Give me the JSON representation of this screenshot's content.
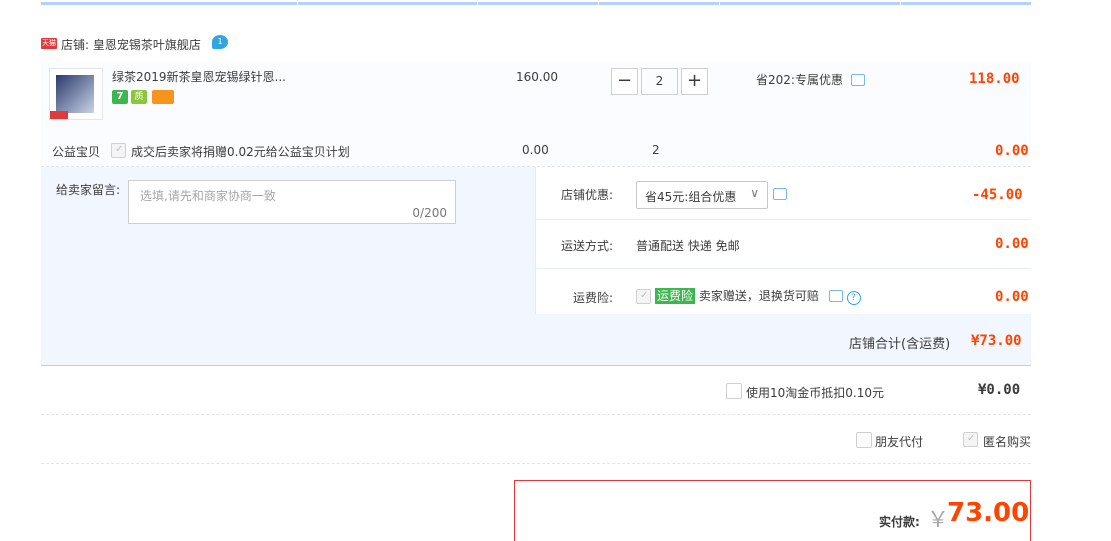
{
  "shop": {
    "badge": "天猫",
    "label": "店铺: 皇恩宠锡茶叶旗舰店",
    "wangwang": "1"
  },
  "item": {
    "title": "绿茶2019新茶皇恩宠锡绿针恩...",
    "badges": [
      {
        "icon": "seven-day-return-icon",
        "color": "#3db64e",
        "text": "7"
      },
      {
        "icon": "certified-icon",
        "color": "#8cc63f",
        "text": "质"
      },
      {
        "icon": "credit-card-icon",
        "color": "#f7941d",
        "text": ""
      }
    ],
    "unit_price": "160.00",
    "quantity": "2",
    "promo": "省202:专属优惠",
    "subtotal": "118.00"
  },
  "charity": {
    "label": "公益宝贝",
    "text": "成交后卖家将捐赠0.02元给公益宝贝计划",
    "price": "0.00",
    "quantity": "2",
    "subtotal": "0.00"
  },
  "message": {
    "label": "给卖家留言:",
    "placeholder": "选填,请先和商家协商一致",
    "counter": "0/200"
  },
  "shop_discount": {
    "label": "店铺优惠:",
    "selected": "省45元:组合优惠",
    "amount": "-45.00"
  },
  "shipping": {
    "label": "运送方式:",
    "value": "普通配送 快递 免邮",
    "amount": "0.00"
  },
  "insurance": {
    "label": "运费险:",
    "badge": "运费险",
    "text": "卖家赠送，退换货可赔",
    "amount": "0.00"
  },
  "shop_total": {
    "label": "店铺合计(含运费)",
    "amount": "¥73.00"
  },
  "coins": {
    "label": "使用10淘金币抵扣0.10元",
    "amount": "¥0.00"
  },
  "options": {
    "friend_pay": "朋友代付",
    "anonymous": "匿名购买"
  },
  "payment": {
    "label": "实付款:",
    "currency": "￥",
    "amount": "73.00"
  },
  "colors": {
    "accent_red": "#ff4400",
    "border_blue": "#b2d1ff",
    "pay_border": "#e4393c"
  }
}
